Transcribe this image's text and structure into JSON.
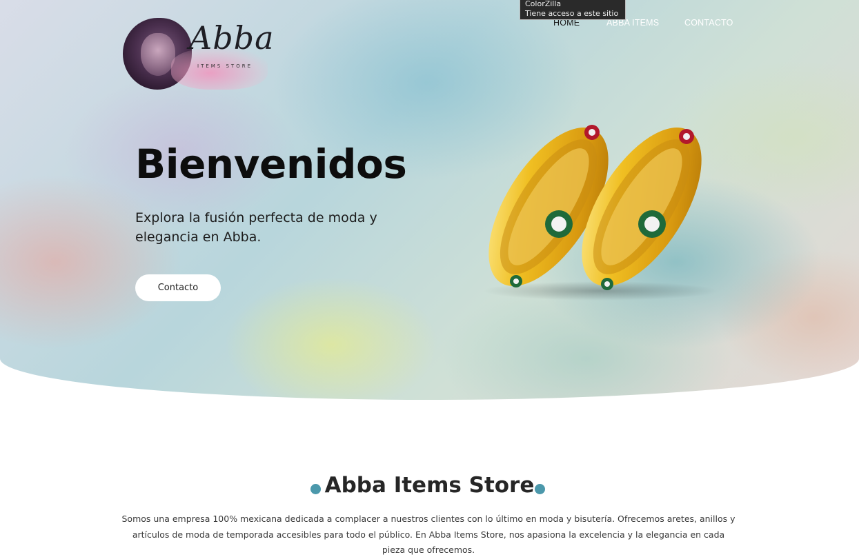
{
  "logo": {
    "wordmark": "Abba",
    "subtitle": "ITEMS STORE"
  },
  "tooltip": {
    "line1": "ColorZilla",
    "line2": "Tiene acceso a este sitio"
  },
  "nav": {
    "items": [
      {
        "label": "HOME",
        "active": true
      },
      {
        "label": "ABBA ITEMS",
        "active": false
      },
      {
        "label": "CONTACTO",
        "active": false
      }
    ]
  },
  "hero": {
    "title": "Bienvenidos",
    "subtitle": "Explora la fusión perfecta de moda y elegancia en Abba.",
    "button_label": "Contacto"
  },
  "about": {
    "title": "Abba Items Store",
    "text": "Somos una empresa 100% mexicana dedicada a complacer a nuestros clientes con lo último en moda y bisutería. Ofrecemos aretes, anillos y artículos de moda de temporada accesibles para todo el público. En Abba Items Store, nos apasiona la excelencia y la elegancia en cada pieza que ofrecemos."
  },
  "colors": {
    "accent": "#4b98ab",
    "title": "#0d0d0d",
    "gold": "#e9b21a"
  },
  "icons": {
    "bullet": "dot-icon",
    "bangles": "gold-bangles-image",
    "logo": "lion-logo-icon"
  }
}
